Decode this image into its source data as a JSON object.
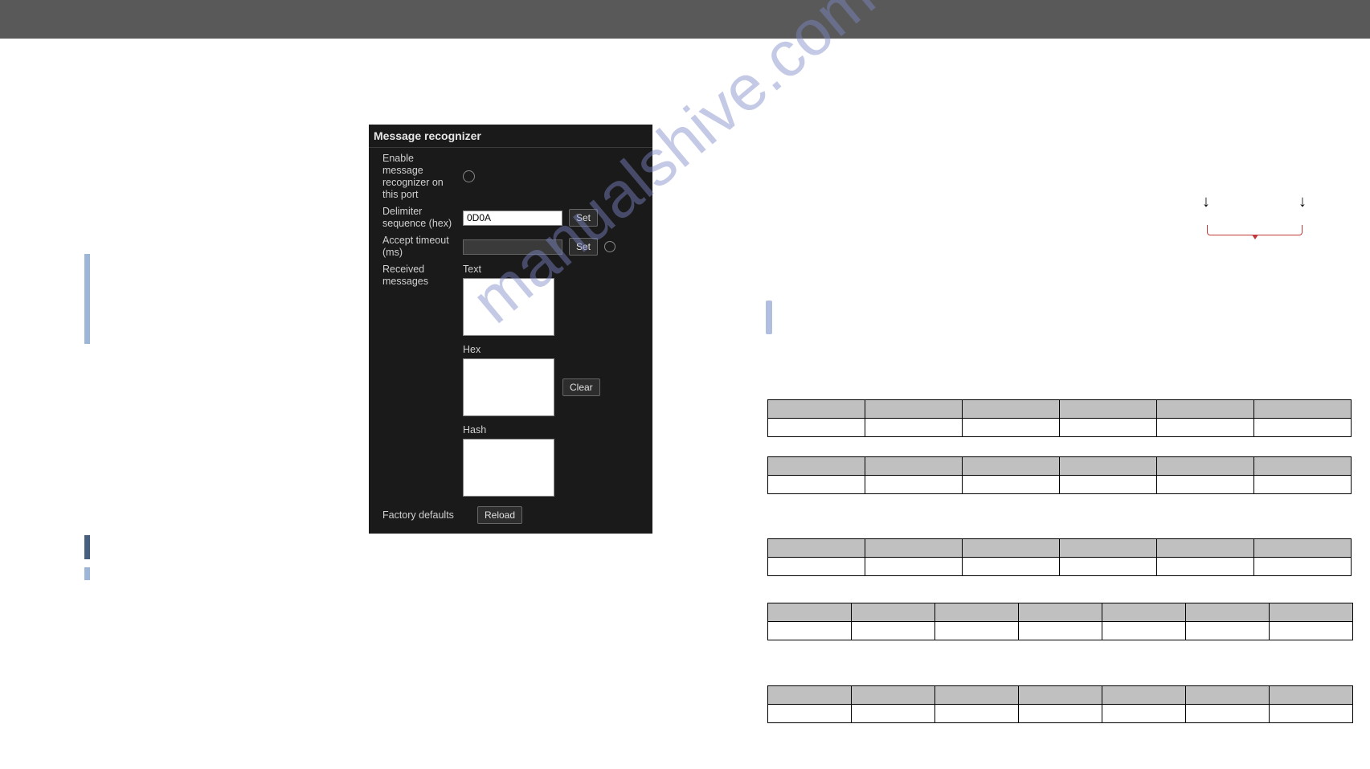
{
  "top_bar": {},
  "panel": {
    "title": "Message recognizer",
    "enable_label": "Enable message recognizer on this port",
    "delimiter_label": "Delimiter sequence (hex)",
    "delimiter_value": "0D0A",
    "delimiter_set": "Set",
    "timeout_label": "Accept timeout (ms)",
    "timeout_value": "",
    "timeout_set": "Set",
    "received_label": "Received messages",
    "text_label": "Text",
    "hex_label": "Hex",
    "clear": "Clear",
    "hash_label": "Hash",
    "factory_label": "Factory defaults",
    "reload": "Reload"
  },
  "watermark": "manualshive.com",
  "tables": {
    "t1": {
      "cols": 6
    },
    "t2": {
      "cols": 6
    },
    "t3": {
      "cols": 6
    },
    "t4": {
      "cols": 7
    },
    "t5": {
      "cols": 7
    }
  }
}
